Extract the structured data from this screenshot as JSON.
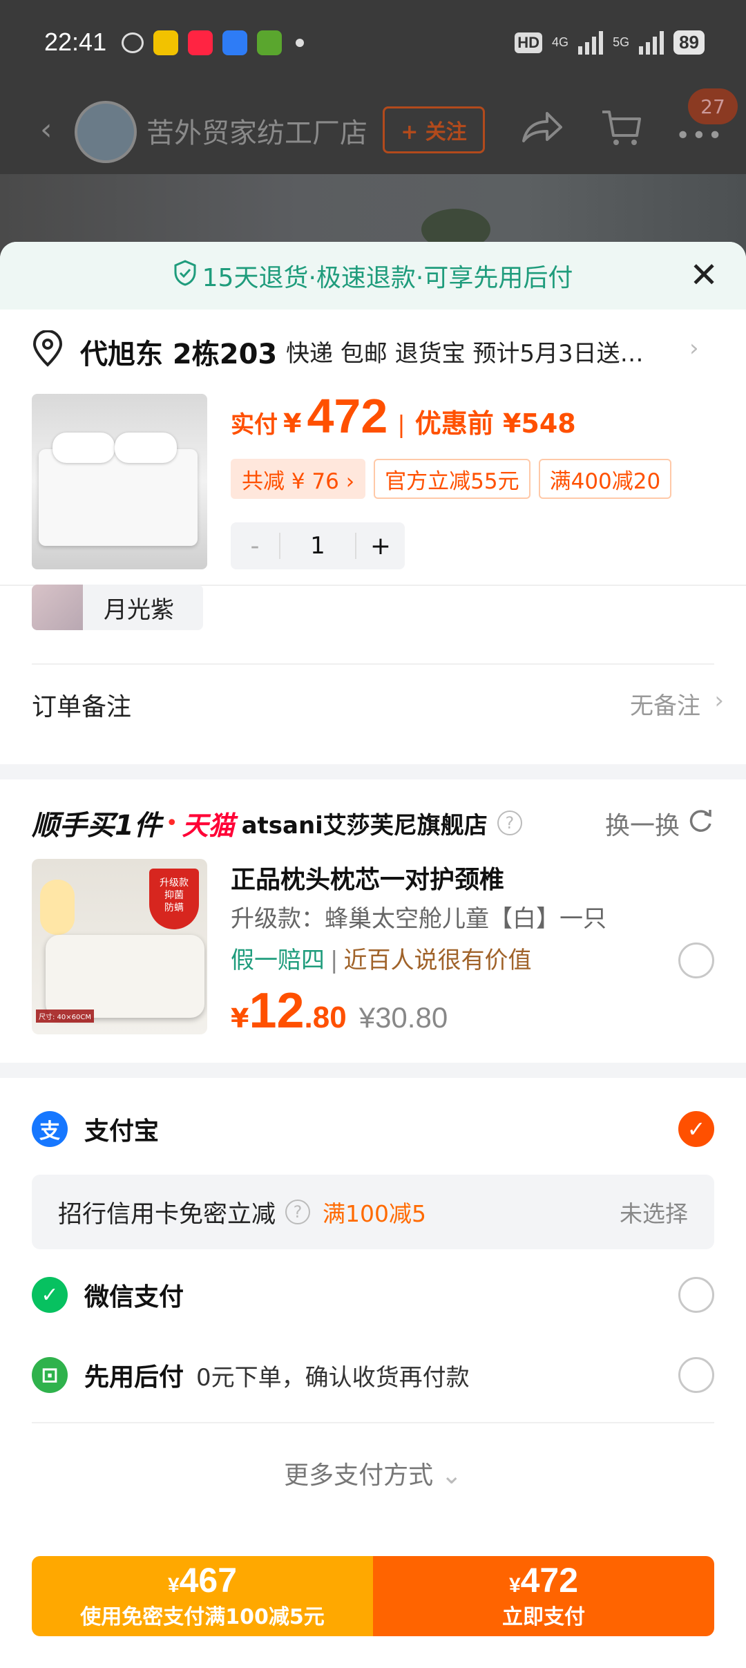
{
  "status_bar": {
    "time": "22:41",
    "hd": "HD",
    "network_4g": "4G",
    "network_5g": "5G",
    "battery": "89"
  },
  "shop_header": {
    "shop_name": "苦外贸家纺工厂店",
    "follow_label": "+ 关注",
    "cart_badge": "27"
  },
  "sheet": {
    "notice": "15天退货·极速退款·可享先用后付",
    "address": {
      "name": "代旭东 2栋203",
      "delivery": "快递 包邮 退货宝 预计5月3日送…"
    },
    "product": {
      "price_label": "实付",
      "currency": "¥",
      "price": "472",
      "original_label": "优惠前 ¥548",
      "tags": [
        "共减 ¥ 76 ›",
        "官方立减55元",
        "满400减20"
      ],
      "quantity": "1",
      "minus": "-",
      "plus": "+"
    },
    "variant": "月光紫",
    "order_note": {
      "label": "订单备注",
      "value": "无备注"
    }
  },
  "recommend": {
    "brand": "顺手买1件",
    "platform": "天猫",
    "store": "atsani艾莎芙尼旗舰店",
    "swap_label": "换一换",
    "image_badge": "升级款 抑菌防螨",
    "title": "正品枕头枕芯一对护颈椎",
    "subtitle": "升级款：蜂巢太空舱儿童【白】一只",
    "guarantee": "假一赔四",
    "review": "近百人说很有价值",
    "price_symbol": "¥",
    "price_int": "12",
    "price_dec": ".80",
    "original_price": "¥30.80"
  },
  "payment": {
    "alipay": "支付宝",
    "card_offer": {
      "label": "招行信用卡免密立减",
      "promo": "满100减5",
      "value": "未选择"
    },
    "wechat": "微信支付",
    "pay_later": {
      "name": "先用后付",
      "desc": "0元下单，确认收货再付款"
    },
    "more": "更多支付方式"
  },
  "bottom": {
    "left_symbol": "¥",
    "left_amount": "467",
    "left_label": "使用免密支付满100减5元",
    "right_symbol": "¥",
    "right_amount": "472",
    "right_label": "立即支付"
  },
  "colors": {
    "accent": "#ff5000",
    "alipay": "#1677ff",
    "wechat": "#07c160",
    "green_notice": "#1f9c7c"
  },
  "icons": [
    "back-arrow-icon",
    "share-icon",
    "cart-icon",
    "more-icon",
    "shield-check-icon",
    "close-icon",
    "location-pin-icon",
    "chevron-right-icon",
    "help-icon",
    "refresh-icon",
    "alipay-icon",
    "wechat-pay-icon",
    "pay-later-icon",
    "chevron-down-icon"
  ]
}
